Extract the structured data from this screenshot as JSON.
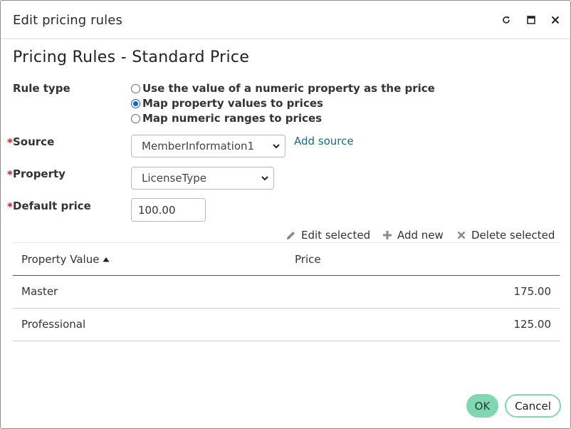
{
  "window": {
    "title": "Edit pricing rules",
    "controls": [
      "refresh-icon",
      "maximize-icon",
      "close-icon"
    ]
  },
  "heading": "Pricing Rules - Standard Price",
  "rule_type": {
    "label": "Rule type",
    "options": [
      {
        "label": "Use the value of a numeric property as the price",
        "checked": false
      },
      {
        "label": "Map property values to prices",
        "checked": true
      },
      {
        "label": "Map numeric ranges to prices",
        "checked": false
      }
    ]
  },
  "source": {
    "required_marker": "*",
    "label": "Source",
    "value": "MemberInformation1",
    "add_link": "Add source"
  },
  "property": {
    "required_marker": "*",
    "label": "Property",
    "value": "LicenseType"
  },
  "default_price": {
    "required_marker": "*",
    "label": "Default price",
    "value": "100.00"
  },
  "toolbar": {
    "edit_label": "Edit selected",
    "add_label": "Add new",
    "delete_label": "Delete selected"
  },
  "table": {
    "columns": [
      "Property Value",
      "Price"
    ],
    "sort": {
      "column": "Property Value",
      "direction": "ascending"
    },
    "rows": [
      {
        "value": "Master",
        "price": "175.00"
      },
      {
        "value": "Professional",
        "price": "125.00"
      }
    ]
  },
  "footer": {
    "ok_label": "OK",
    "cancel_label": "Cancel"
  },
  "colors": {
    "accent": "#7fd8b2",
    "link": "#1a6a8e",
    "required": "#d0191f",
    "radio_checked": "#0b63d4"
  }
}
